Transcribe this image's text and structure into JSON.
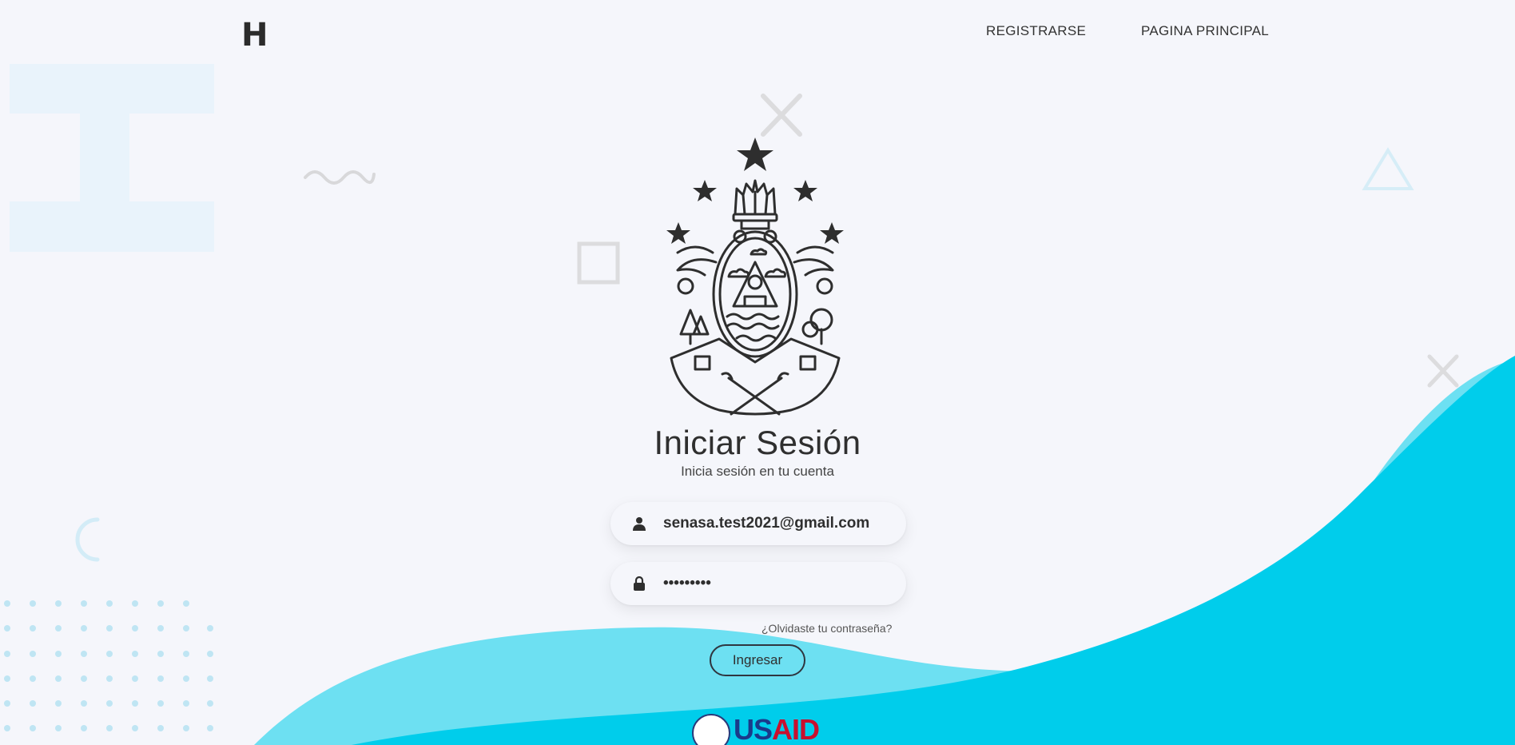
{
  "header": {
    "logo_letter": "H",
    "nav": {
      "register_label": "REGISTRARSE",
      "home_label": "PAGINA PRINCIPAL"
    }
  },
  "login": {
    "title": "Iniciar Sesión",
    "subtitle": "Inicia sesión en tu cuenta",
    "email_value": "senasa.test2021@gmail.com",
    "password_value": "•••••••••",
    "forgot_label": "¿Olvidaste tu contraseña?",
    "submit_label": "Ingresar"
  },
  "footer": {
    "partner_logo_us": "US",
    "partner_logo_aid": "AID"
  },
  "icons": {
    "user": "user-icon",
    "lock": "lock-icon",
    "emblem": "honduras-coat-of-arms-icon"
  },
  "colors": {
    "background": "#f5f6fb",
    "wave_light": "#6de0f2",
    "wave_dark": "#00cdeb",
    "text_dark": "#2f2f2f",
    "usaid_blue": "#1a3a8a",
    "usaid_red": "#c8102e"
  }
}
